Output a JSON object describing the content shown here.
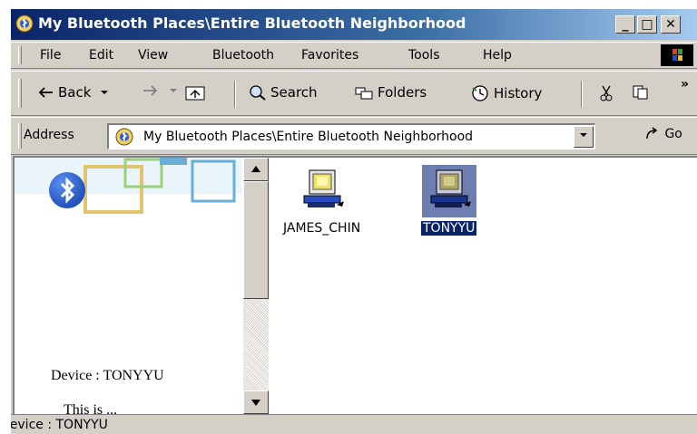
{
  "window": {
    "title": "My Bluetooth Places\\Entire Bluetooth Neighborhood",
    "min_label": "_",
    "max_label": "□",
    "close_label": "✕"
  },
  "menu": {
    "items": [
      "File",
      "Edit",
      "View",
      "Bluetooth",
      "Favorites",
      "Tools",
      "Help"
    ]
  },
  "toolbar": {
    "back_label": "Back",
    "search_label": "Search",
    "folders_label": "Folders",
    "history_label": "History",
    "chevron": "»"
  },
  "address": {
    "label": "Address",
    "value": "My Bluetooth Places\\Entire Bluetooth Neighborhood",
    "go_label": "Go"
  },
  "left_pane": {
    "device_text": "Device : TONYYU",
    "cut_text": "This is ..."
  },
  "devices": [
    {
      "name": "JAMES_CHIN",
      "selected": false
    },
    {
      "name": "TONYYU",
      "selected": true
    }
  ],
  "status": {
    "text": "Device : TONYYU"
  },
  "colors": {
    "title_bar": "#0a246a",
    "selection": "#0a246a",
    "chrome": "#d4d0c8"
  }
}
